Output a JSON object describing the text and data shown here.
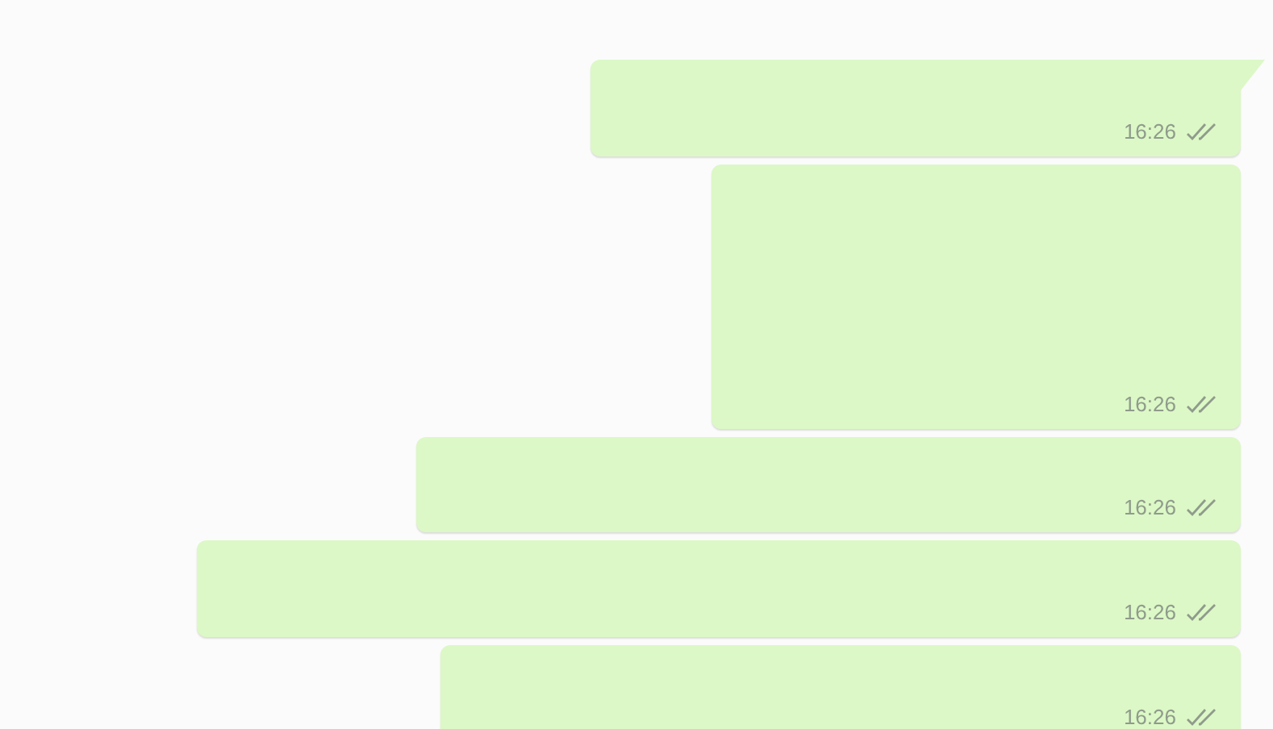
{
  "messages": [
    {
      "time": "16:26",
      "read": false,
      "tail": true
    },
    {
      "time": "16:26",
      "read": false,
      "tail": false
    },
    {
      "time": "16:26",
      "read": false,
      "tail": false
    },
    {
      "time": "16:26",
      "read": false,
      "tail": false
    },
    {
      "time": "16:26",
      "read": false,
      "tail": false
    }
  ]
}
